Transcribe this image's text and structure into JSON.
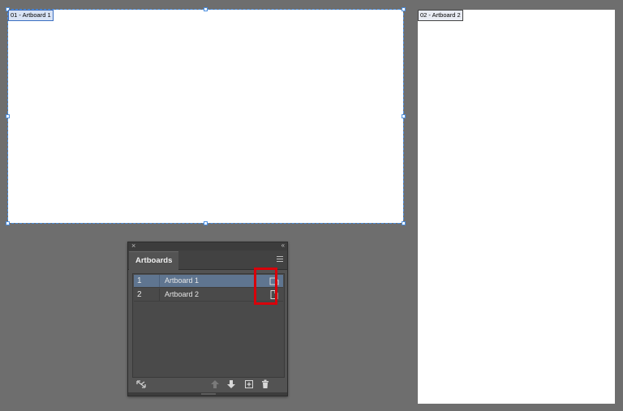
{
  "canvas": {
    "artboards": [
      {
        "label": "01 - Artboard 1",
        "selected": true
      },
      {
        "label": "02 - Artboard 2",
        "selected": false
      }
    ]
  },
  "panel": {
    "tab_label": "Artboards",
    "close_glyph": "×",
    "collapse_glyph": "‹‹",
    "rows": [
      {
        "number": "1",
        "name": "Artboard 1",
        "selected": true,
        "icon": "artboard-options-landscape-icon"
      },
      {
        "number": "2",
        "name": "Artboard 2",
        "selected": false,
        "icon": "artboard-options-portrait-icon"
      }
    ],
    "footer_icons": [
      "rearrange-icon",
      "move-up-icon",
      "move-down-icon",
      "new-artboard-icon",
      "delete-icon"
    ]
  },
  "colors": {
    "workspace": "#6e6e6e",
    "selection": "#4a8ee0",
    "row_selected": "#5f7590",
    "highlight": "#d8000a"
  }
}
